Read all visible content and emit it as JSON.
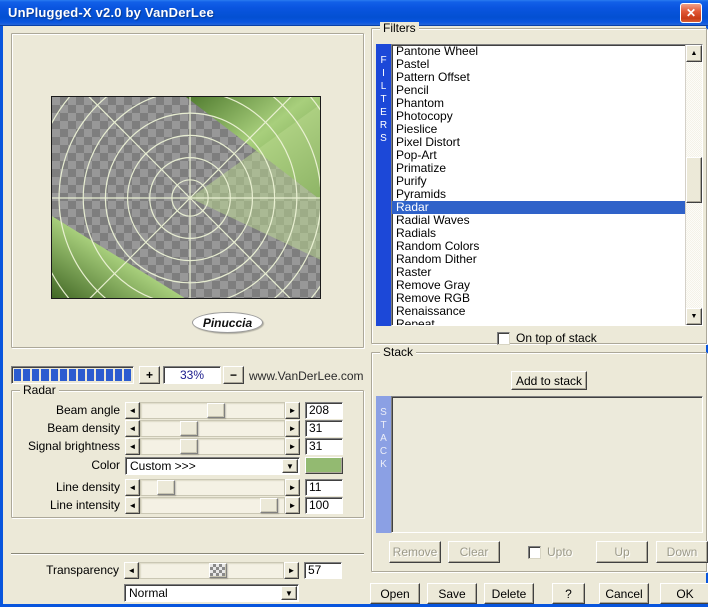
{
  "window": {
    "title": "UnPlugged-X v2.0 by VanDerLee",
    "close_glyph": "✕"
  },
  "preview": {
    "watermark": "Pinuccia"
  },
  "progress": {
    "segments": 13,
    "plus_label": "+",
    "zoom_value": "33%",
    "minus_label": "−",
    "website": "www.VanDerLee.com"
  },
  "radar": {
    "group_label": "Radar",
    "params": [
      {
        "label": "Beam angle",
        "value": "208",
        "pos": 53
      },
      {
        "label": "Beam density",
        "value": "31",
        "pos": 31
      },
      {
        "label": "Signal brightness",
        "value": "31",
        "pos": 31
      },
      {
        "label": "Line density",
        "value": "11",
        "pos": 13
      },
      {
        "label": "Line intensity",
        "value": "100",
        "pos": 95
      }
    ],
    "color": {
      "label": "Color",
      "dropdown_value": "Custom >>>"
    },
    "transparency": {
      "label": "Transparency",
      "value": "57",
      "pos": 55
    },
    "blend_mode": "Normal"
  },
  "filters": {
    "group_label": "Filters",
    "side_label": "FILTERS",
    "items": [
      "Pantone Wheel",
      "Pastel",
      "Pattern Offset",
      "Pencil",
      "Phantom",
      "Photocopy",
      "Pieslice",
      "Pixel Distort",
      "Pop-Art",
      "Primatize",
      "Purify",
      "Pyramids",
      "Radar",
      "Radial Waves",
      "Radials",
      "Random Colors",
      "Random Dither",
      "Raster",
      "Remove Gray",
      "Remove RGB",
      "Renaissance",
      "Repeat"
    ],
    "selected": "Radar",
    "on_top_label": "On top of stack"
  },
  "stack": {
    "group_label": "Stack",
    "side_label": "STACK",
    "add_button": "Add to stack",
    "remove_button": "Remove",
    "clear_button": "Clear",
    "upto_label": "Upto",
    "up_button": "Up",
    "down_button": "Down"
  },
  "footer": {
    "open": "Open",
    "save": "Save",
    "delete": "Delete",
    "help": "?",
    "cancel": "Cancel",
    "ok": "OK"
  },
  "colors": {
    "titlebar_blue": "#0a55e0",
    "selection_blue": "#2f62c9",
    "filters_bar_blue": "#1c48d8",
    "stack_bar_blue": "#8ba0e4",
    "progress_blue": "#2b5cd0",
    "swatch_green": "#93ba71"
  }
}
